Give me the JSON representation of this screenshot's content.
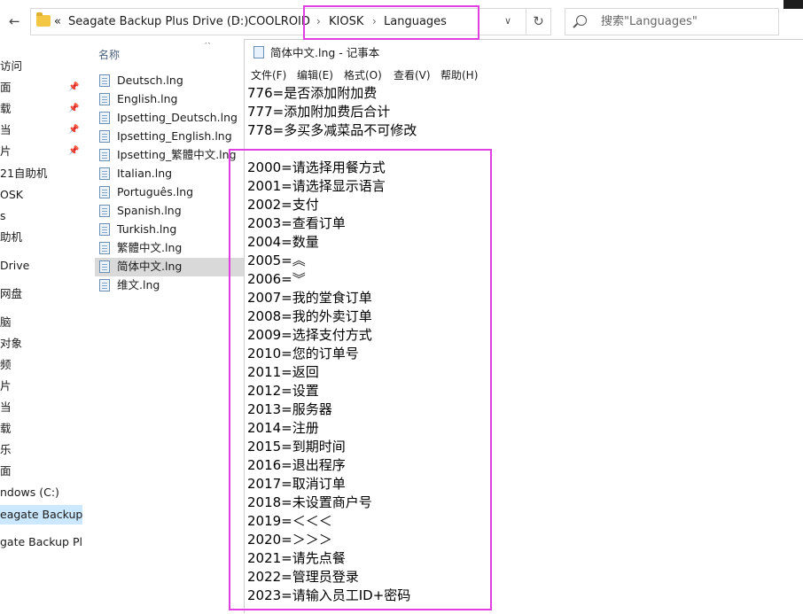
{
  "explorer": {
    "address": {
      "overflow": "«",
      "drive": "Seagate Backup Plus Drive (D:)",
      "folder1": "COOLROID",
      "folder2": "KIOSK",
      "folder3": "Languages",
      "separator": "›"
    },
    "search_placeholder": "搜索\"Languages\"",
    "column_name": "名称",
    "nav_items": [
      {
        "label": "访问"
      },
      {
        "label": "面"
      },
      {
        "label": "载"
      },
      {
        "label": "当"
      },
      {
        "label": "片"
      },
      {
        "label": "21自助机"
      },
      {
        "label": "OSK"
      },
      {
        "label": "s"
      },
      {
        "label": "助机"
      },
      {
        "label": "Drive"
      },
      {
        "label": "网盘"
      },
      {
        "label": "脑"
      },
      {
        "label": "对象"
      },
      {
        "label": "频"
      },
      {
        "label": "片"
      },
      {
        "label": "当"
      },
      {
        "label": "载"
      },
      {
        "label": "乐"
      },
      {
        "label": "面"
      },
      {
        "label": "ndows (C:)"
      },
      {
        "label": "eagate Backup Pl"
      },
      {
        "label": "gate Backup Plus"
      }
    ],
    "files": [
      {
        "name": "Deutsch.lng"
      },
      {
        "name": "English.lng"
      },
      {
        "name": "Ipsetting_Deutsch.lng"
      },
      {
        "name": "Ipsetting_English.lng"
      },
      {
        "name": "Ipsetting_繁體中文.lng"
      },
      {
        "name": "Italian.lng"
      },
      {
        "name": "Português.lng"
      },
      {
        "name": "Spanish.lng"
      },
      {
        "name": "Turkish.lng"
      },
      {
        "name": "繁體中文.lng"
      },
      {
        "name": "简体中文.lng"
      },
      {
        "name": "维文.lng"
      }
    ],
    "selected_file_index": 10
  },
  "notepad": {
    "title": "简体中文.lng - 记事本",
    "menu": [
      "文件(F)",
      "编辑(E)",
      "格式(O)",
      "查看(V)",
      "帮助(H)"
    ],
    "lines": [
      "776=是否添加附加费",
      "777=添加附加费后合计",
      "778=多买多减菜品不可修改",
      "",
      "2000=请选择用餐方式",
      "2001=请选择显示语言",
      "2002=支付",
      "2003=查看订单",
      "2004=数量",
      "2005=︽",
      "2006=︾",
      "2007=我的堂食订单",
      "2008=我的外卖订单",
      "2009=选择支付方式",
      "2010=您的订单号",
      "2011=返回",
      "2012=设置",
      "2013=服务器",
      "2014=注册",
      "2015=到期时间",
      "2016=退出程序",
      "2017=取消订单",
      "2018=未设置商户号",
      "2019=＜＜＜",
      "2020=＞＞＞",
      "2021=请先点餐",
      "2022=管理员登录",
      "2023=请输入员工ID+密码"
    ]
  },
  "colors": {
    "highlight": "#e040e0",
    "selected_row": "#d9d9d9"
  }
}
